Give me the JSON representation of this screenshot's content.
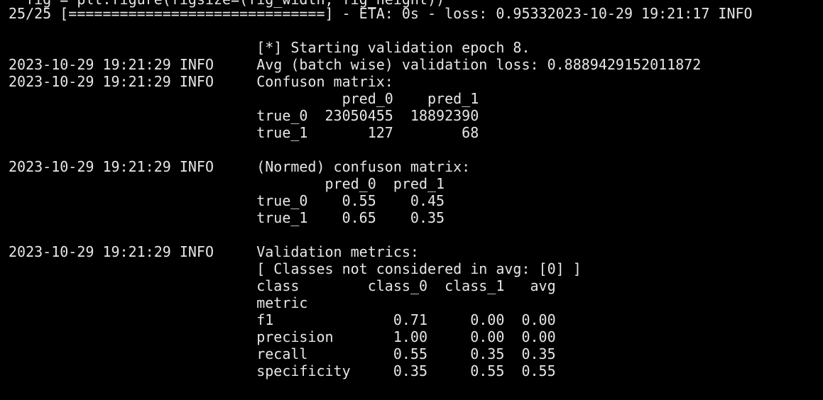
{
  "terminal": {
    "lines": [
      "  fig = plt.figure(figsize=(fig_width, fig_height))",
      "25/25 [==============================] - ETA: 0s - loss: 0.95332023-10-29 19:21:17 INFO",
      "",
      "                             [*] Starting validation epoch 8.",
      "2023-10-29 19:21:29 INFO     Avg (batch wise) validation loss: 0.8889429152011872",
      "2023-10-29 19:21:29 INFO     Confuson matrix:",
      "                                       pred_0    pred_1",
      "                             true_0  23050455  18892390",
      "                             true_1       127        68",
      "",
      "2023-10-29 19:21:29 INFO     (Normed) confuson matrix:",
      "                                     pred_0  pred_1",
      "                             true_0    0.55    0.45",
      "                             true_1    0.65    0.35",
      "",
      "2023-10-29 19:21:29 INFO     Validation metrics:",
      "                             [ Classes not considered in avg: [0] ]",
      "                             class        class_0  class_1   avg",
      "                             metric",
      "                             f1              0.71     0.00  0.00",
      "                             precision       1.00     0.00  0.00",
      "                             recall          0.55     0.35  0.35",
      "                             specificity     0.35     0.55  0.55"
    ]
  }
}
